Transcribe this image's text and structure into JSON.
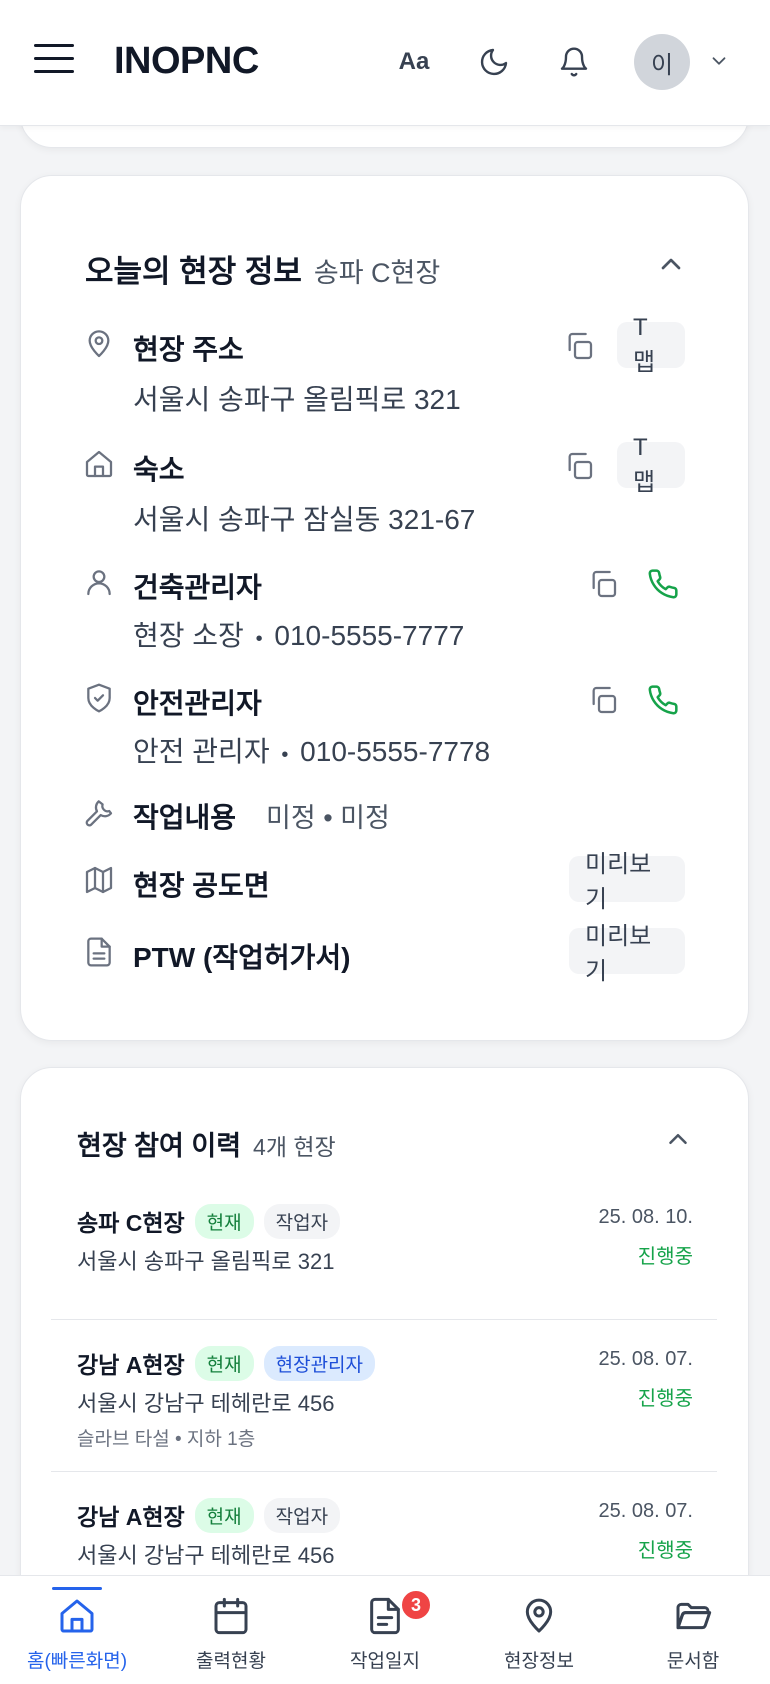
{
  "header": {
    "logo": "INOPNC",
    "font_label": "Aa",
    "avatar_initial": "이"
  },
  "site_info": {
    "title": "오늘의 현장 정보",
    "site_name": "송파 C현장",
    "address": {
      "label": "현장 주소",
      "value": "서울시 송파구 올림픽로 321",
      "map_btn": "T맵"
    },
    "lodging": {
      "label": "숙소",
      "value": "서울시 송파구 잠실동 321-67",
      "map_btn": "T맵"
    },
    "building_manager": {
      "label": "건축관리자",
      "role": "현장 소장",
      "phone": "010-5555-7777",
      "separator": "•"
    },
    "safety_manager": {
      "label": "안전관리자",
      "role": "안전 관리자",
      "phone": "010-5555-7778",
      "separator": "•"
    },
    "work": {
      "label": "작업내용",
      "value": "미정 • 미정"
    },
    "drawing": {
      "label": "현장 공도면",
      "btn": "미리보기"
    },
    "ptw": {
      "label": "PTW (작업허가서)",
      "btn": "미리보기"
    }
  },
  "history": {
    "title": "현장 참여 이력",
    "count": "4개 현장",
    "rows": [
      {
        "name": "송파 C현장",
        "badge_now": "현재",
        "role": "작업자",
        "address": "서울시 송파구 올림픽로 321",
        "detail": "",
        "date": "25. 08. 10.",
        "status": "진행중"
      },
      {
        "name": "강남 A현장",
        "badge_now": "현재",
        "role": "현장관리자",
        "address": "서울시 강남구 테헤란로 456",
        "detail": "슬라브 타설  •  지하 1층",
        "date": "25. 08. 07.",
        "status": "진행중"
      },
      {
        "name": "강남 A현장",
        "badge_now": "현재",
        "role": "작업자",
        "address": "서울시 강남구 테헤란로 456",
        "detail": "",
        "date": "25. 08. 07.",
        "status": "진행중"
      }
    ]
  },
  "tabs": [
    {
      "label": "홈(빠른화면)",
      "icon": "home-icon",
      "active": true
    },
    {
      "label": "출력현황",
      "icon": "calendar-icon",
      "active": false
    },
    {
      "label": "작업일지",
      "icon": "document-icon",
      "badge": "3",
      "active": false
    },
    {
      "label": "현장정보",
      "icon": "map-pin-icon",
      "active": false
    },
    {
      "label": "문서함",
      "icon": "folder-icon",
      "active": false
    }
  ],
  "colors": {
    "accent": "#2563eb",
    "green": "#16a34a",
    "badge_red": "#ef4444"
  }
}
